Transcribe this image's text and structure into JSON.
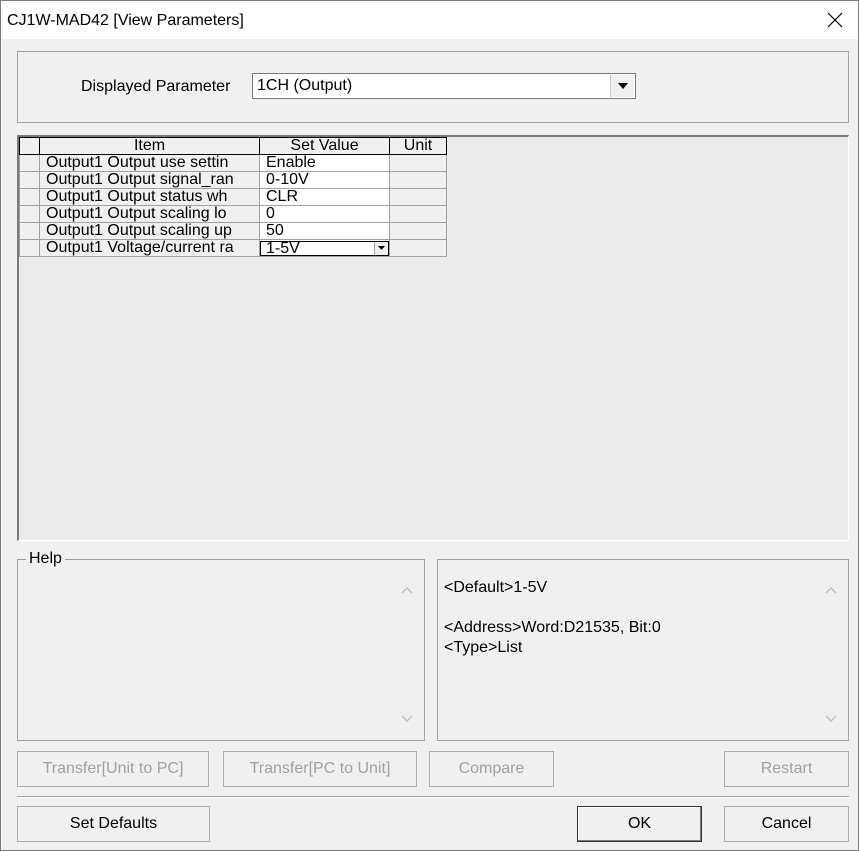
{
  "window": {
    "title": "CJ1W-MAD42 [View Parameters]"
  },
  "displayed_parameter": {
    "label": "Displayed Parameter",
    "value": "1CH (Output)"
  },
  "grid": {
    "headers": [
      "Item",
      "Set Value",
      "Unit"
    ],
    "rows": [
      {
        "item": "Output1 Output use settin",
        "value": "Enable",
        "unit": ""
      },
      {
        "item": "Output1 Output signal_ran",
        "value": "0-10V",
        "unit": ""
      },
      {
        "item": "Output1 Output status wh",
        "value": "CLR",
        "unit": ""
      },
      {
        "item": "Output1 Output scaling lo",
        "value": "0",
        "unit": ""
      },
      {
        "item": "Output1 Output scaling up",
        "value": "50",
        "unit": ""
      },
      {
        "item": "Output1 Voltage/current ra",
        "value": "1-5V",
        "unit": ""
      }
    ]
  },
  "help": {
    "label": "Help",
    "text": ""
  },
  "details": {
    "default": "<Default>1-5V",
    "address": "<Address>Word:D21535, Bit:0",
    "type": "<Type>List"
  },
  "buttons": {
    "transfer_unit_to_pc": "Transfer[Unit to PC]",
    "transfer_pc_to_unit": "Transfer[PC to Unit]",
    "compare": "Compare",
    "restart": "Restart",
    "set_defaults": "Set Defaults",
    "ok": "OK",
    "cancel": "Cancel"
  }
}
